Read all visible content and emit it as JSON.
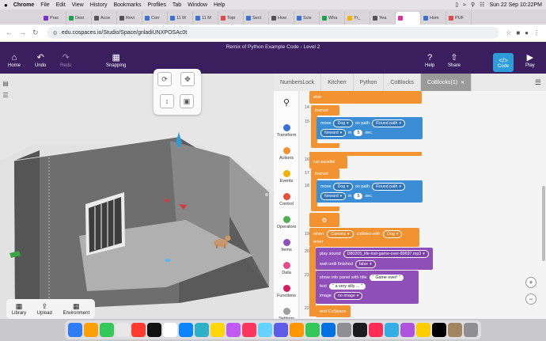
{
  "macbar": {
    "app": "Chrome",
    "menus": [
      "File",
      "Edit",
      "View",
      "History",
      "Bookmarks",
      "Profiles",
      "Tab",
      "Window",
      "Help"
    ],
    "clock": "Sun 22 Sep  10:22PM"
  },
  "tabs": [
    {
      "label": "Prac",
      "color": "#7a2fd4"
    },
    {
      "label": "Desi",
      "color": "#19a34a"
    },
    {
      "label": "Acce",
      "color": "#555555"
    },
    {
      "label": "Revi",
      "color": "#555555"
    },
    {
      "label": "Corr",
      "color": "#3a71d6"
    },
    {
      "label": "11 M",
      "color": "#3a71d6"
    },
    {
      "label": "11 M",
      "color": "#3a71d6"
    },
    {
      "label": "Topi",
      "color": "#e04848"
    },
    {
      "label": "Sect",
      "color": "#3a71d6"
    },
    {
      "label": "How",
      "color": "#555555"
    },
    {
      "label": "Scie",
      "color": "#3a71d6"
    },
    {
      "label": "Wha",
      "color": "#19a34a"
    },
    {
      "label": "Yr_",
      "color": "#f2b400"
    },
    {
      "label": "Yea",
      "color": "#555555"
    },
    {
      "label": "",
      "color": "#e0319a",
      "active": true
    },
    {
      "label": "Hom",
      "color": "#3a71d6"
    },
    {
      "label": "PUF",
      "color": "#e04848"
    }
  ],
  "address": {
    "url": "edu.cospaces.io/Studio/Space/gnladiUNXPOSAc0t"
  },
  "app": {
    "title": "Remix of Python Example Code - Level 2",
    "home": "Home",
    "undo": "Undo",
    "redo": "Redo",
    "snapping": "Snapping",
    "help": "Help",
    "share": "Share",
    "code": "Code",
    "play": "Play"
  },
  "bottombar": {
    "library": "Library",
    "upload": "Upload",
    "environment": "Environment"
  },
  "code_tabs": [
    {
      "label": "NumbersLock"
    },
    {
      "label": "Kitchen"
    },
    {
      "label": "Python"
    },
    {
      "label": "CoBlocks"
    },
    {
      "label": "CoBlocks(1)",
      "active": true
    }
  ],
  "categories": [
    {
      "label": "Transform",
      "color": "#3a71d6"
    },
    {
      "label": "Actions",
      "color": "#f29231"
    },
    {
      "label": "Events",
      "color": "#f2b400"
    },
    {
      "label": "Control",
      "color": "#e5503a"
    },
    {
      "label": "Operators",
      "color": "#4caf50"
    },
    {
      "label": "Items",
      "color": "#8e4fb9"
    },
    {
      "label": "Data",
      "color": "#e64a8a"
    },
    {
      "label": "Functions",
      "color": "#d81b60"
    },
    {
      "label": "Settings",
      "color": "#9e9e9e"
    }
  ],
  "code": {
    "line_numbers": [
      "14",
      "15",
      "16",
      "17",
      "18",
      "19",
      "20",
      "21",
      "22"
    ],
    "else": "else",
    "forever": "forever",
    "move": "move",
    "dog": "Dog",
    "on_path": "on path",
    "round_path": "Round path",
    "forward": "forward",
    "in": "in",
    "five": "5",
    "sec": "sec.",
    "run_parallel": "run parallel",
    "when": "when",
    "camera": "Camera",
    "collides_with": "collides with",
    "enter": "enter",
    "play_sound": "play sound",
    "sound_file": "D80205_life-lost-game-over-89697.mp3",
    "wait_until_finished": "wait until finished",
    "false": "false",
    "show_info": "show info panel with title",
    "game_over": "Game over!",
    "text": "text",
    "very_silly": "a very silly ...",
    "image": "image",
    "no_image": "no image",
    "end_cospace": "end CoSpace"
  },
  "zoom": {
    "plus": "+",
    "minus": "−"
  }
}
